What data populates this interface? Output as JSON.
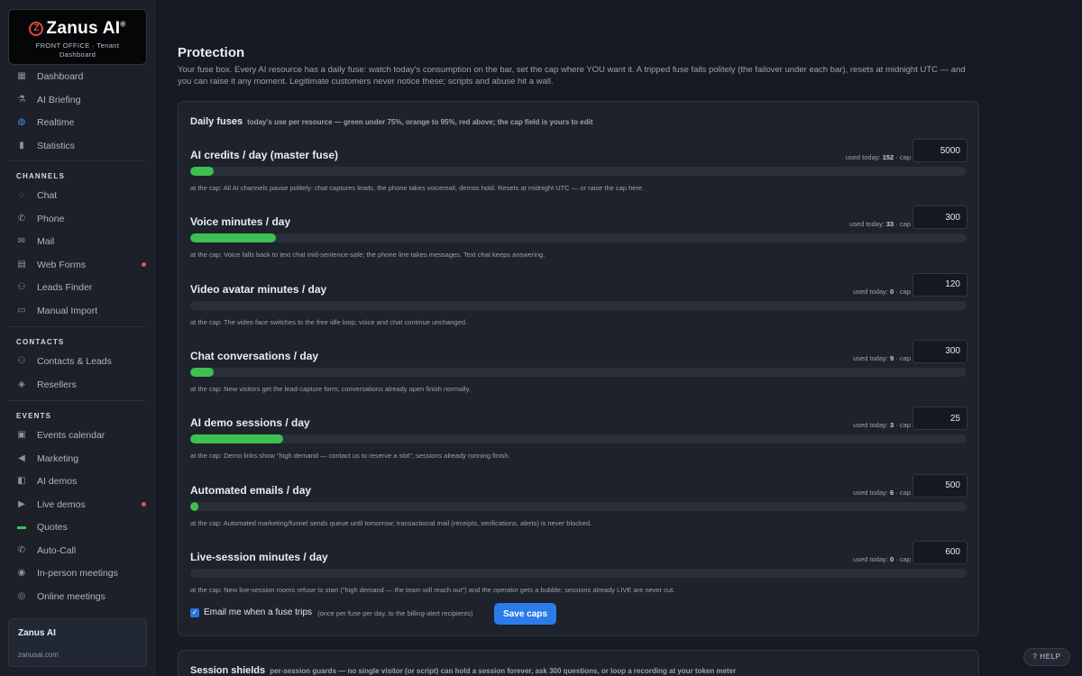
{
  "brand": {
    "name": "Zanus AI",
    "logo_letter": "Z",
    "wordmark": "Zanus AI",
    "registered": "®",
    "subtitle_line1": "FRONT OFFICE · Tenant",
    "subtitle_line2": "Dashboard",
    "accent": "#e0483e"
  },
  "sidebar": {
    "top_items": [
      {
        "label": "Dashboard",
        "icon": "grid-icon"
      },
      {
        "label": "AI Briefing",
        "icon": "briefing-icon"
      },
      {
        "label": "Realtime",
        "icon": "globe-icon"
      },
      {
        "label": "Statistics",
        "icon": "chart-icon"
      }
    ],
    "channels_title": "CHANNELS",
    "channels": [
      {
        "label": "Chat",
        "icon": "chat-icon"
      },
      {
        "label": "Phone",
        "icon": "phone-icon"
      },
      {
        "label": "Mail",
        "icon": "mail-icon"
      },
      {
        "label": "Web Forms",
        "icon": "form-icon",
        "badge": true
      },
      {
        "label": "Leads Finder",
        "icon": "leads-finder-icon"
      },
      {
        "label": "Manual Import",
        "icon": "import-icon"
      }
    ],
    "contacts_title": "CONTACTS",
    "contacts": [
      {
        "label": "Contacts & Leads",
        "icon": "contacts-icon"
      },
      {
        "label": "Resellers",
        "icon": "handshake-icon"
      }
    ],
    "events_title": "EVENTS",
    "events": [
      {
        "label": "Events calendar",
        "icon": "calendar-icon"
      },
      {
        "label": "Marketing",
        "icon": "megaphone-icon"
      },
      {
        "label": "AI demos",
        "icon": "ai-demo-icon"
      },
      {
        "label": "Live demos",
        "icon": "live-demo-icon",
        "badge": true
      },
      {
        "label": "Quotes",
        "icon": "quote-icon"
      },
      {
        "label": "Auto-Call",
        "icon": "auto-call-icon"
      },
      {
        "label": "In-person meetings",
        "icon": "pin-icon"
      },
      {
        "label": "Online meetings",
        "icon": "online-meeting-icon"
      }
    ],
    "company": {
      "name": "Zanus AI",
      "url": "zanusai.com"
    }
  },
  "page": {
    "title": "Protection",
    "description": "Your fuse box. Every AI resource has a daily fuse: watch today's consumption on the bar, set the cap where YOU want it. A tripped fuse fails politely (the failover under each bar), resets at midnight UTC — and you can raise it any moment. Legitimate customers never notice these; scripts and abuse hit a wall."
  },
  "daily_fuses": {
    "title": "Daily fuses",
    "subtitle": "today's use per resource — green under 75%, orange to 95%, red above; the cap field is yours to edit",
    "used_prefix": "used today:",
    "cap_suffix": "· cap",
    "fuses": [
      {
        "title": "AI credits / day (master fuse)",
        "used": "152",
        "cap": "5000",
        "fill": 0.03,
        "note": "at the cap: All AI channels pause politely: chat captures leads, the phone takes voicemail, demos hold. Resets at midnight UTC — or raise the cap here."
      },
      {
        "title": "Voice minutes / day",
        "used": "33",
        "cap": "300",
        "fill": 0.11,
        "note": "at the cap: Voice falls back to text chat mid-sentence-safe; the phone line takes messages. Text chat keeps answering."
      },
      {
        "title": "Video avatar minutes / day",
        "used": "0",
        "cap": "120",
        "fill": 0,
        "note": "at the cap: The video face switches to the free idle loop; voice and chat continue unchanged."
      },
      {
        "title": "Chat conversations / day",
        "used": "9",
        "cap": "300",
        "fill": 0.03,
        "note": "at the cap: New visitors get the lead-capture form; conversations already open finish normally."
      },
      {
        "title": "AI demo sessions / day",
        "used": "3",
        "cap": "25",
        "fill": 0.12,
        "note": "at the cap: Demo links show \"high demand — contact us to reserve a slot\"; sessions already running finish."
      },
      {
        "title": "Automated emails / day",
        "used": "6",
        "cap": "500",
        "fill": 0.01,
        "note": "at the cap: Automated marketing/funnel sends queue until tomorrow; transactional mail (receipts, verifications, alerts) is never blocked."
      },
      {
        "title": "Live-session minutes / day",
        "used": "0",
        "cap": "600",
        "fill": 0,
        "note": "at the cap: New live-session rooms refuse to start (\"high demand — the team will reach out\") and the operator gets a bubble; sessions already LIVE are never cut."
      }
    ],
    "email_label": "Email me when a fuse trips",
    "email_hint": "(once per fuse per day, to the billing-alert recipients)",
    "email_checked": true,
    "save_label": "Save caps",
    "green": "#3fbf4f"
  },
  "session_shields": {
    "title": "Session shields",
    "subtitle": "per-session guards — no single visitor (or script) can hold a session forever, ask 300 questions, or loop a recording at your token meter"
  },
  "help_label": "? HELP"
}
